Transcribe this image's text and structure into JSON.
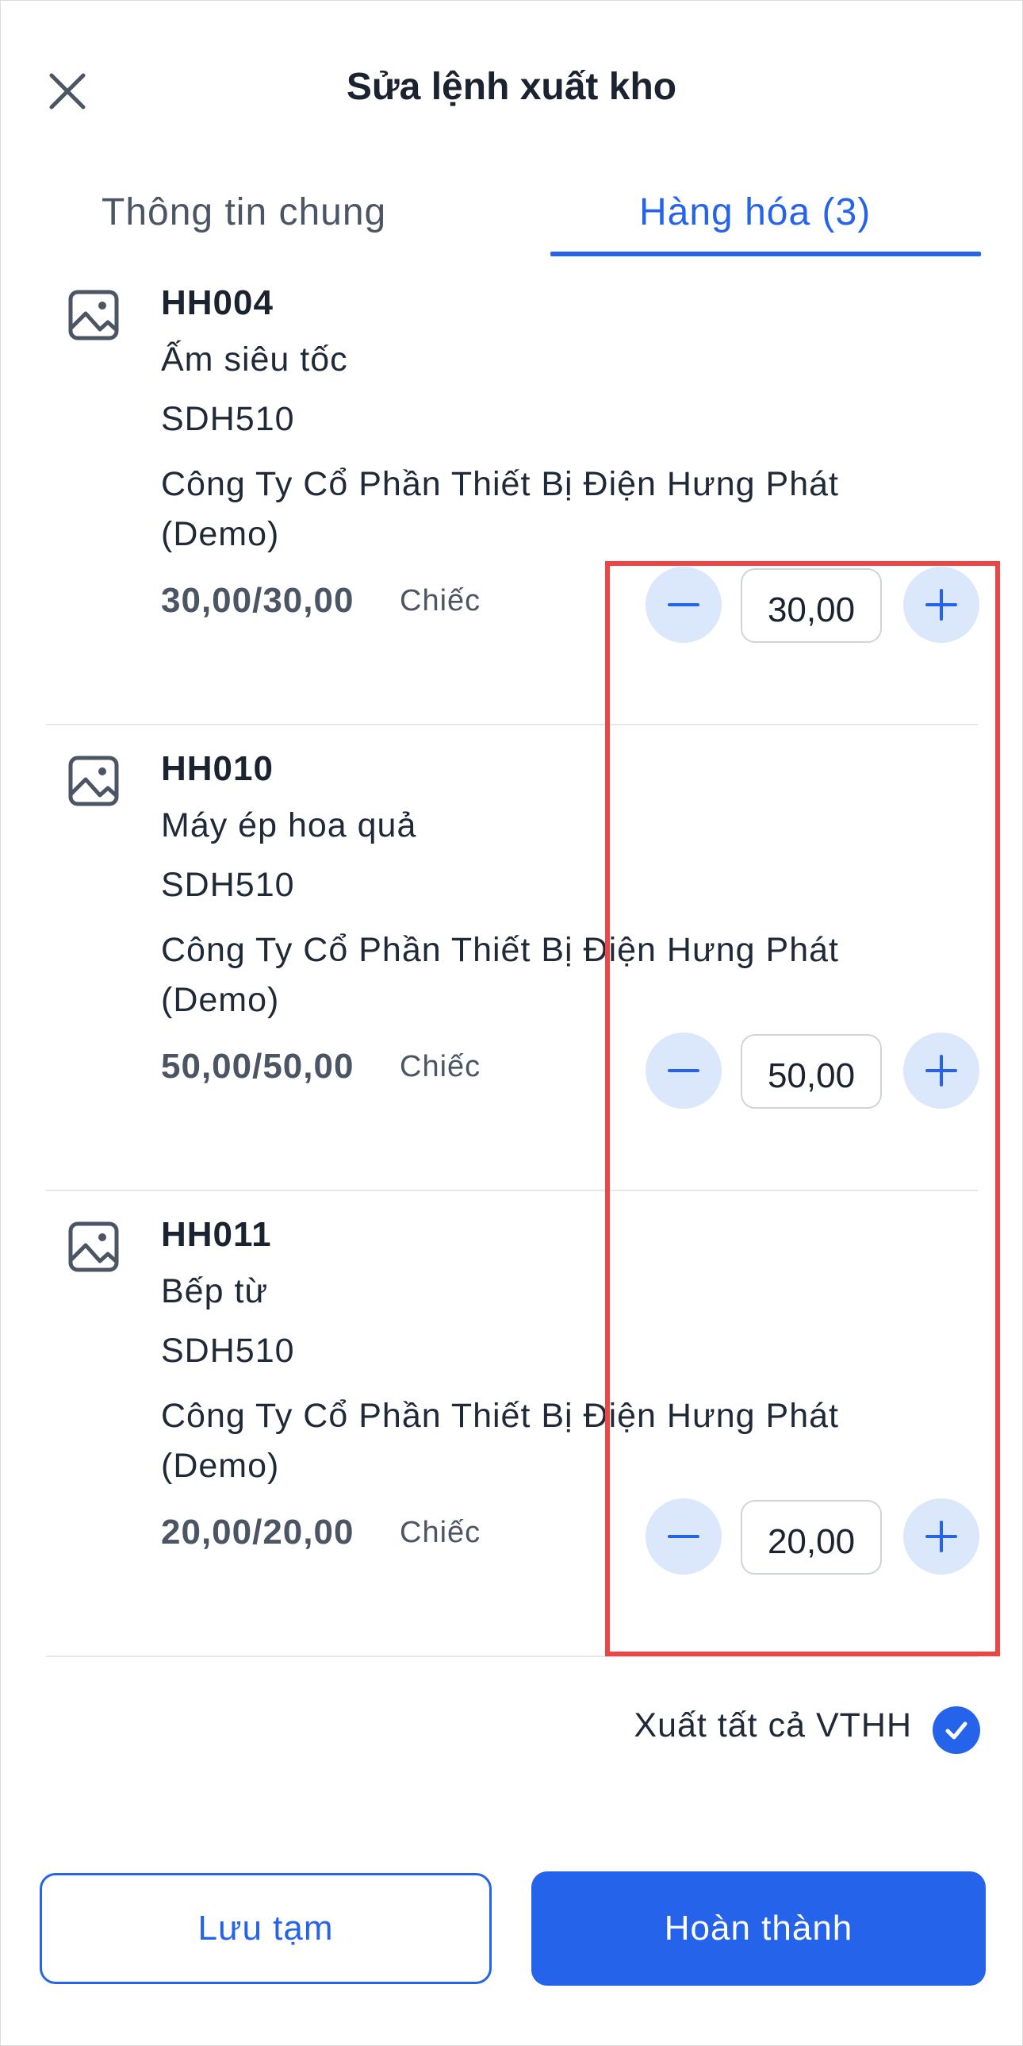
{
  "header": {
    "title": "Sửa lệnh xuất kho",
    "close_icon": "close-icon"
  },
  "tabs": [
    {
      "label": "Thông tin chung",
      "active": false
    },
    {
      "label": "Hàng hóa (3)",
      "active": true
    }
  ],
  "items": [
    {
      "code": "HH004",
      "name": "Ấm siêu tốc",
      "sku": "SDH510",
      "supplier": "Công Ty Cổ Phần Thiết Bị Điện Hưng Phát (Demo)",
      "qty_ratio": "30,00/30,00",
      "unit": "Chiếc",
      "qty_value": "30,00"
    },
    {
      "code": "HH010",
      "name": "Máy ép hoa quả",
      "sku": "SDH510",
      "supplier": "Công Ty Cổ Phần Thiết Bị Điện Hưng Phát (Demo)",
      "qty_ratio": "50,00/50,00",
      "unit": "Chiếc",
      "qty_value": "50,00"
    },
    {
      "code": "HH011",
      "name": "Bếp từ",
      "sku": "SDH510",
      "supplier": "Công Ty Cổ Phần Thiết Bị Điện Hưng Phát (Demo)",
      "qty_ratio": "20,00/20,00",
      "unit": "Chiếc",
      "qty_value": "20,00"
    }
  ],
  "export_all": {
    "label": "Xuất tất cả VTHH",
    "checked": true
  },
  "footer": {
    "save_label": "Lưu tạm",
    "done_label": "Hoàn thành"
  },
  "colors": {
    "accent": "#2563eb",
    "stepper_bg": "#dbe7fb",
    "highlight": "#ef4444"
  }
}
